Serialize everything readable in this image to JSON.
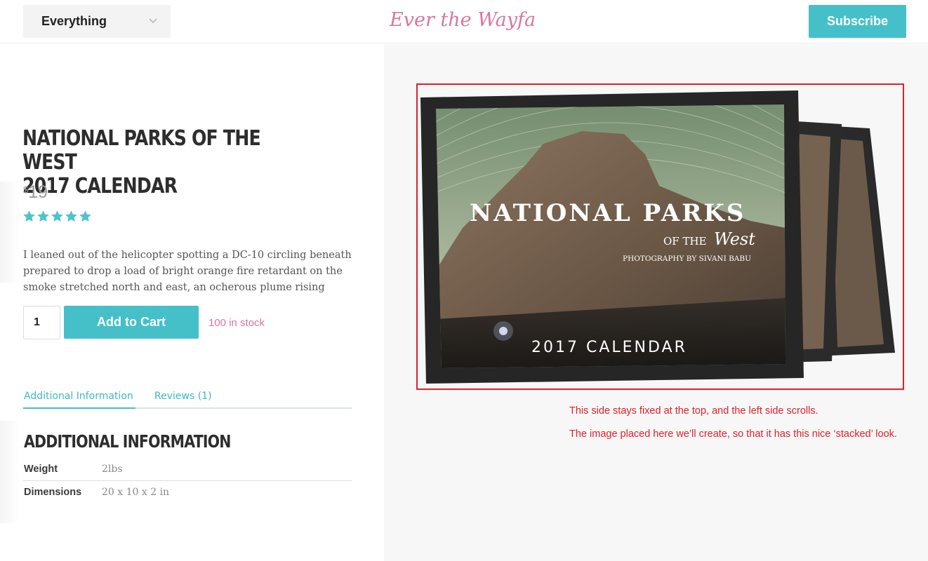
{
  "header": {
    "search_scope": "Everything",
    "logo_text": "Ever the Wayfarer",
    "subscribe_label": "Subscribe"
  },
  "product": {
    "title_line1": "NATIONAL PARKS OF THE WEST",
    "title_line2": "2017 CALENDAR",
    "price_currency": "$",
    "price_amount": "19",
    "rating": 5,
    "rating_max": 5,
    "description": "I leaned out of the helicopter spotting a DC-10 circling beneath prepared to drop a load of bright orange fire retardant on the smoke stretched north and east, an ocherous plume rising",
    "quantity": "1",
    "add_to_cart_label": "Add to Cart",
    "stock_text": "100 in stock"
  },
  "tabs": [
    {
      "label": "Additional Information",
      "active": true
    },
    {
      "label": "Reviews (1)",
      "active": false
    }
  ],
  "additional_info": {
    "heading": "ADDITIONAL INFORMATION",
    "rows": [
      {
        "key": "Weight",
        "value": "2lbs"
      },
      {
        "key": "Dimensions",
        "value": "20 x 10 x 2 in"
      }
    ]
  },
  "calendar_image": {
    "title": "NATIONAL PARKS",
    "subtitle_prefix": "OF THE",
    "subtitle_script": "West",
    "credit": "PHOTOGRAPHY BY SIVANI BABU",
    "year_text": "2017 CALENDAR"
  },
  "annotations": {
    "note_1": "This side stays fixed at the top, and the left side scrolls.",
    "note_2": "The image placed here we’ll create, so that it has this nice ‘stacked’ look."
  },
  "colors": {
    "accent": "#45c0c8",
    "brand_pink": "#d9769e",
    "annotation_red": "#e0202a",
    "star": "#4fc3cb"
  }
}
